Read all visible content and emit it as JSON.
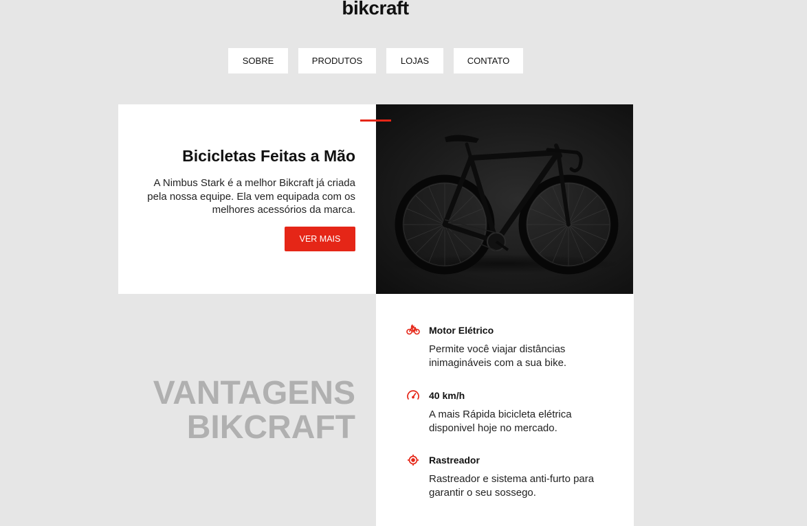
{
  "brand": {
    "logo_text": "bikcraft"
  },
  "nav": {
    "items": [
      {
        "label": "SOBRE"
      },
      {
        "label": "PRODUTOS"
      },
      {
        "label": "LOJAS"
      },
      {
        "label": "CONTATO"
      }
    ]
  },
  "hero": {
    "title": "Bicicletas Feitas a Mão",
    "text": "A Nimbus Stark é a melhor Bikcraft já criada pela nossa equipe. Ela vem equipada com os melhores acessórios da marca.",
    "button_label": "VER MAIS",
    "image_subject": "black road bicycle"
  },
  "advantages": {
    "title_line1": "VANTAGENS",
    "title_line2": "BIKCRAFT",
    "items": [
      {
        "icon": "electric-bike-icon",
        "title": "Motor Elétrico",
        "text": "Permite você viajar distâncias inimagináveis com a sua bike."
      },
      {
        "icon": "speedometer-icon",
        "title": "40 km/h",
        "text": "A mais Rápida bicicleta elétrica disponivel hoje no mercado."
      },
      {
        "icon": "target-icon",
        "title": "Rastreador",
        "text": "Rastreador e sistema anti-furto para garantir o seu sossego."
      }
    ]
  },
  "colors": {
    "accent": "#e52617",
    "background": "#e6e6e6",
    "muted_heading": "#b0b0b0"
  }
}
